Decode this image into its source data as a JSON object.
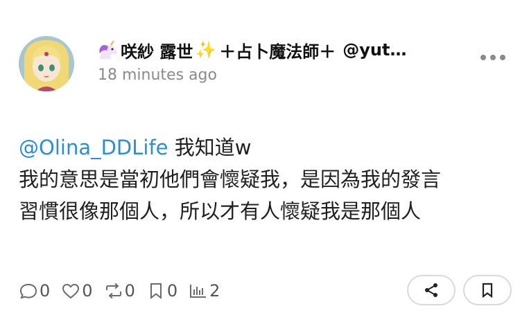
{
  "post": {
    "author": {
      "emoji_icon": "unicorn-icon",
      "name_part1": "咲紗 露世",
      "sparkle": "✨",
      "name_part2": "＋占卜魔法師＋",
      "handle": "@yut…"
    },
    "timestamp": "18 minutes ago",
    "body": {
      "mention": "@Olina_DDLife",
      "line1_rest": " 我知道w",
      "line2": "我的意思是當初他們會懷疑我，是因為我的發言",
      "line3": "習慣很像那個人，所以才有人懷疑我是那個人"
    },
    "stats": {
      "replies": "0",
      "likes": "0",
      "reposts": "0",
      "quotes": "0",
      "views": "2"
    }
  },
  "colors": {
    "mention": "#2b8dd6",
    "timestamp": "#8a8a8a",
    "icon_gray": "#6b6b6b"
  }
}
